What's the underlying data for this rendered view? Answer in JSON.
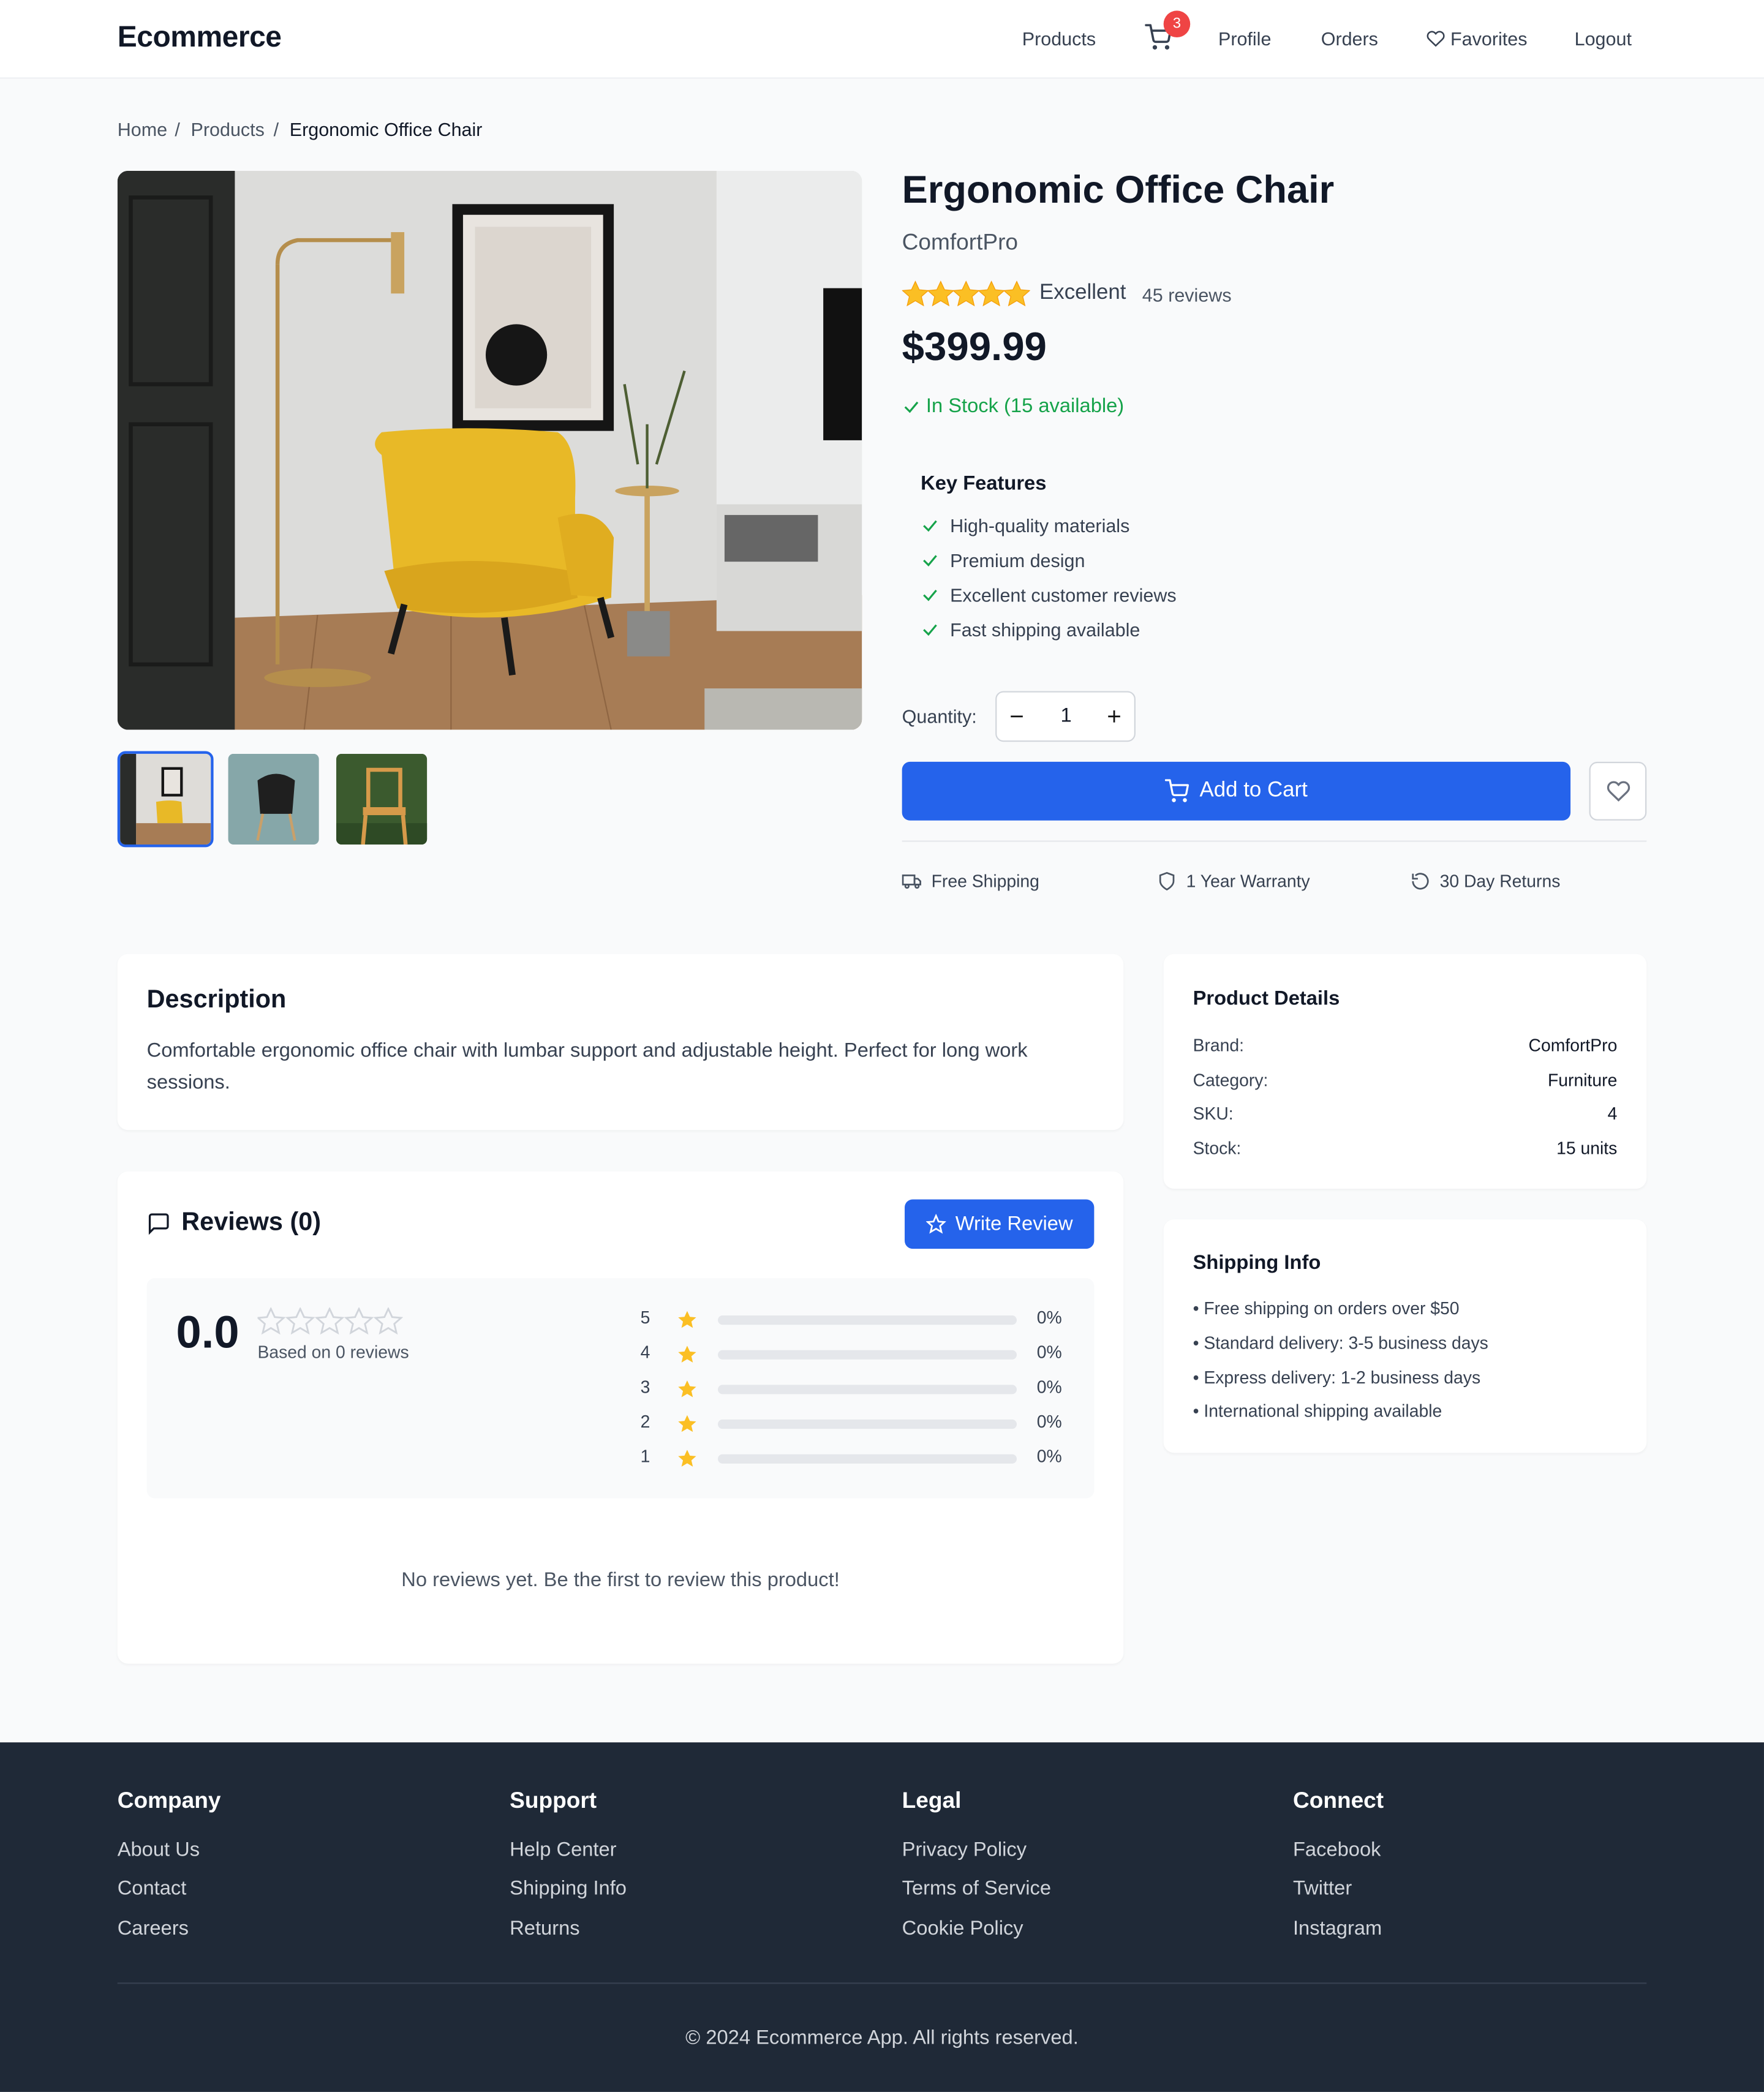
{
  "header": {
    "brand": "Ecommerce",
    "nav": {
      "products": "Products",
      "profile": "Profile",
      "orders": "Orders",
      "favorites": "Favorites",
      "logout": "Logout"
    },
    "cart_count": "3"
  },
  "breadcrumb": {
    "home": "Home",
    "products": "Products",
    "current": "Ergonomic Office Chair",
    "separator": "/"
  },
  "product": {
    "title": "Ergonomic Office Chair",
    "brand": "ComfortPro",
    "rating_label": "Excellent",
    "review_count": "45 reviews",
    "price": "$399.99",
    "stock": "In Stock (15 available)",
    "key_features_title": "Key Features",
    "features": [
      "High-quality materials",
      "Premium design",
      "Excellent customer reviews",
      "Fast shipping available"
    ],
    "quantity_label": "Quantity:",
    "quantity": "1",
    "add_to_cart": "Add to Cart",
    "perks": [
      "Free Shipping",
      "1 Year Warranty",
      "30 Day Returns"
    ]
  },
  "description": {
    "title": "Description",
    "text": "Comfortable ergonomic office chair with lumbar support and adjustable height. Perfect for long work sessions."
  },
  "reviews": {
    "title": "Reviews (0)",
    "write_button": "Write Review",
    "average": "0.0",
    "based_on": "Based on 0 reviews",
    "distribution": [
      {
        "stars": "5",
        "percent": "0%"
      },
      {
        "stars": "4",
        "percent": "0%"
      },
      {
        "stars": "3",
        "percent": "0%"
      },
      {
        "stars": "2",
        "percent": "0%"
      },
      {
        "stars": "1",
        "percent": "0%"
      }
    ],
    "empty_message": "No reviews yet. Be the first to review this product!"
  },
  "details": {
    "title": "Product Details",
    "rows": [
      {
        "label": "Brand:",
        "value": "ComfortPro"
      },
      {
        "label": "Category:",
        "value": "Furniture"
      },
      {
        "label": "SKU:",
        "value": "4"
      },
      {
        "label": "Stock:",
        "value": "15 units"
      }
    ]
  },
  "shipping": {
    "title": "Shipping Info",
    "items": [
      "• Free shipping on orders over $50",
      "• Standard delivery: 3-5 business days",
      "• Express delivery: 1-2 business days",
      "• International shipping available"
    ]
  },
  "footer": {
    "columns": [
      {
        "title": "Company",
        "links": [
          "About Us",
          "Contact",
          "Careers"
        ]
      },
      {
        "title": "Support",
        "links": [
          "Help Center",
          "Shipping Info",
          "Returns"
        ]
      },
      {
        "title": "Legal",
        "links": [
          "Privacy Policy",
          "Terms of Service",
          "Cookie Policy"
        ]
      },
      {
        "title": "Connect",
        "links": [
          "Facebook",
          "Twitter",
          "Instagram"
        ]
      }
    ],
    "copyright": "© 2024 Ecommerce App. All rights reserved."
  },
  "colors": {
    "primary": "#2563eb",
    "star": "#fbbf24",
    "success": "#16a34a",
    "badge": "#ef4444",
    "footer_bg": "#1f2937"
  },
  "icons": [
    "cart-icon",
    "heart-icon",
    "check-icon",
    "star-icon",
    "truck-icon",
    "shield-icon",
    "rotate-icon",
    "message-icon"
  ]
}
